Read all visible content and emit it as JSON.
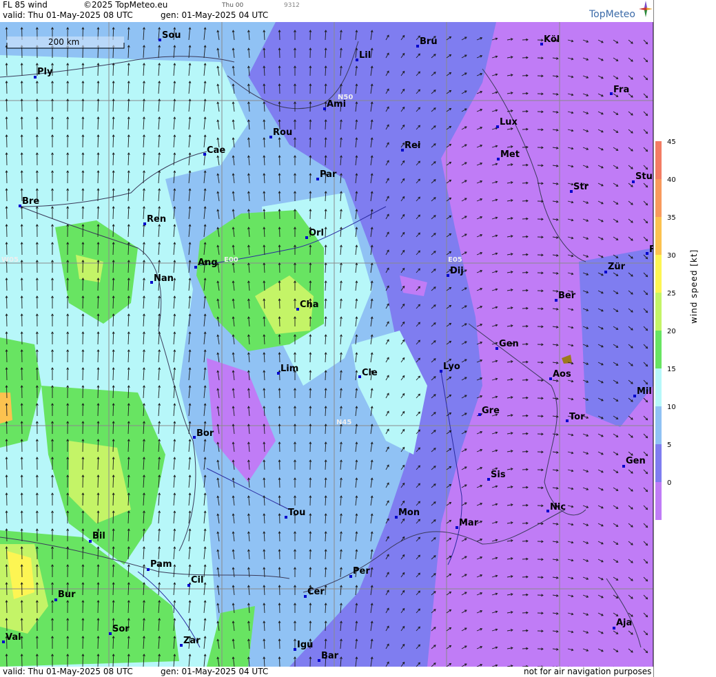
{
  "header": {
    "product": "FL 85 wind",
    "copyright": "©2025 TopMeteo.eu",
    "small_time": "Thu 00",
    "code": "9312",
    "valid": "valid:  Thu  01-May-2025  08 UTC",
    "gen": "gen: 01-May-2025 04 UTC",
    "brand": "TopMeteo"
  },
  "footer": {
    "valid": "valid:  Thu  01-May-2025  08 UTC",
    "gen": "gen: 01-May-2025 04 UTC",
    "disclaimer": "not for air navigation purposes"
  },
  "scale_bar": "200 km",
  "grid_labels": [
    "N50",
    "E05",
    "W05",
    "E00",
    "N45"
  ],
  "cities": [
    "Sou",
    "Ply",
    "Lil",
    "Bru",
    "Köl",
    "Ami",
    "Fra",
    "Lux",
    "Rou",
    "Cae",
    "Rei",
    "Met",
    "Par",
    "Stu",
    "Str",
    "Bre",
    "Ren",
    "Orl",
    "Dij",
    "Nan",
    "Ang",
    "Zür",
    "Ber",
    "Cha",
    "Gen",
    "Lim",
    "Lyo",
    "Cle",
    "Aos",
    "Mil",
    "Gre",
    "Tor",
    "Bor",
    "Gen",
    "Sis",
    "Tou",
    "Mon",
    "Nic",
    "Mar",
    "Bil",
    "Pam",
    "Cil",
    "Per",
    "Bur",
    "Cer",
    "Sor",
    "Val",
    "Zar",
    "Igu",
    "Bar",
    "Aja",
    "F"
  ],
  "legend": {
    "title": "wind speed [kt]",
    "ticks": [
      "45",
      "40",
      "35",
      "30",
      "25",
      "20",
      "15",
      "10",
      "5",
      "0"
    ],
    "colors": [
      "#f37c64",
      "#f89a5c",
      "#fcc24f",
      "#fdf553",
      "#c4f467",
      "#68e462",
      "#b7f7f9",
      "#90c2f4",
      "#7f7df0",
      "#c07cf6"
    ]
  }
}
